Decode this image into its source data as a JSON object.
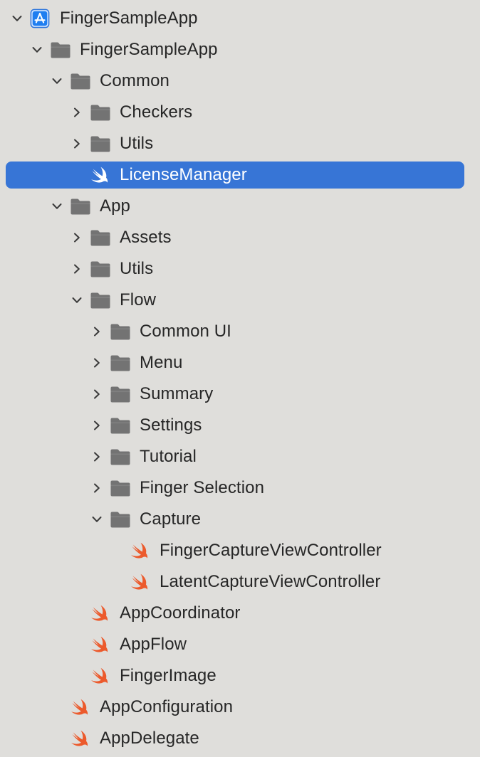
{
  "navigator": {
    "colors": {
      "background": "#dfdedb",
      "selection": "#3775d6",
      "folder": "#737373",
      "swift": "#ec5a2c",
      "project_blue": "#1f7ef0",
      "text": "#262626",
      "selected_text": "#ffffff"
    },
    "items": [
      {
        "label": "FingerSampleApp",
        "kind": "project",
        "depth": 0,
        "expanded": true
      },
      {
        "label": "FingerSampleApp",
        "kind": "folder",
        "depth": 1,
        "expanded": true
      },
      {
        "label": "Common",
        "kind": "folder",
        "depth": 2,
        "expanded": true
      },
      {
        "label": "Checkers",
        "kind": "folder",
        "depth": 3,
        "expanded": false
      },
      {
        "label": "Utils",
        "kind": "folder",
        "depth": 3,
        "expanded": false
      },
      {
        "label": "LicenseManager",
        "kind": "swift",
        "depth": 3,
        "selected": true
      },
      {
        "label": "App",
        "kind": "folder",
        "depth": 2,
        "expanded": true
      },
      {
        "label": "Assets",
        "kind": "folder",
        "depth": 3,
        "expanded": false
      },
      {
        "label": "Utils",
        "kind": "folder",
        "depth": 3,
        "expanded": false
      },
      {
        "label": "Flow",
        "kind": "folder",
        "depth": 3,
        "expanded": true
      },
      {
        "label": "Common UI",
        "kind": "folder",
        "depth": 4,
        "expanded": false
      },
      {
        "label": "Menu",
        "kind": "folder",
        "depth": 4,
        "expanded": false
      },
      {
        "label": "Summary",
        "kind": "folder",
        "depth": 4,
        "expanded": false
      },
      {
        "label": "Settings",
        "kind": "folder",
        "depth": 4,
        "expanded": false
      },
      {
        "label": "Tutorial",
        "kind": "folder",
        "depth": 4,
        "expanded": false
      },
      {
        "label": "Finger Selection",
        "kind": "folder",
        "depth": 4,
        "expanded": false
      },
      {
        "label": "Capture",
        "kind": "folder",
        "depth": 4,
        "expanded": true
      },
      {
        "label": "FingerCaptureViewController",
        "kind": "swift",
        "depth": 5
      },
      {
        "label": "LatentCaptureViewController",
        "kind": "swift",
        "depth": 5
      },
      {
        "label": "AppCoordinator",
        "kind": "swift",
        "depth": 3
      },
      {
        "label": "AppFlow",
        "kind": "swift",
        "depth": 3
      },
      {
        "label": "FingerImage",
        "kind": "swift",
        "depth": 3
      },
      {
        "label": "AppConfiguration",
        "kind": "swift",
        "depth": 2
      },
      {
        "label": "AppDelegate",
        "kind": "swift",
        "depth": 2
      }
    ]
  }
}
